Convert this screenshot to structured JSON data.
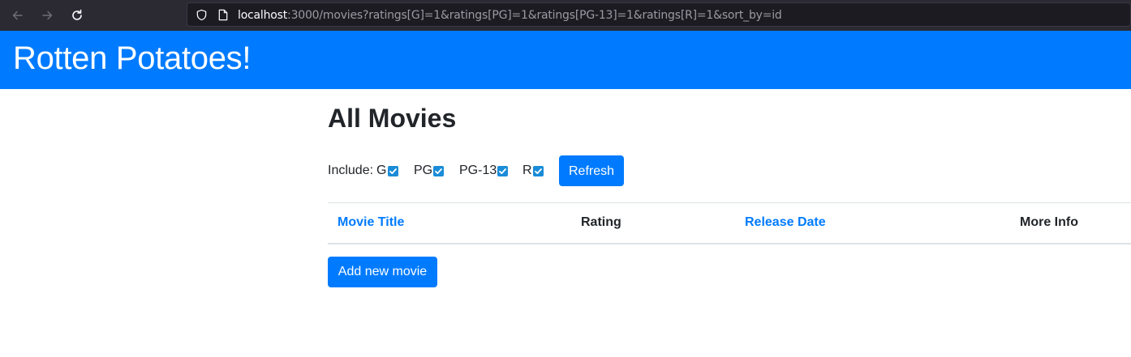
{
  "browser": {
    "url_host": "localhost",
    "url_rest": ":3000/movies?ratings[G]=1&ratings[PG]=1&ratings[PG-13]=1&ratings[R]=1&sort_by=id"
  },
  "header": {
    "title": "Rotten Potatoes!"
  },
  "main": {
    "title": "All Movies",
    "filter": {
      "include_label": "Include:",
      "ratings": [
        {
          "label": "G",
          "checked": true
        },
        {
          "label": "PG",
          "checked": true
        },
        {
          "label": "PG-13",
          "checked": true
        },
        {
          "label": "R",
          "checked": true
        }
      ],
      "refresh_label": "Refresh"
    },
    "table": {
      "columns": [
        {
          "label": "Movie Title",
          "link": true
        },
        {
          "label": "Rating",
          "link": false
        },
        {
          "label": "Release Date",
          "link": true
        },
        {
          "label": "More Info",
          "link": false
        }
      ],
      "rows": []
    },
    "add_movie_label": "Add new movie"
  },
  "colors": {
    "accent": "#007bff",
    "checkbox": "#1a8cd8",
    "chrome": "#2b2a33"
  }
}
